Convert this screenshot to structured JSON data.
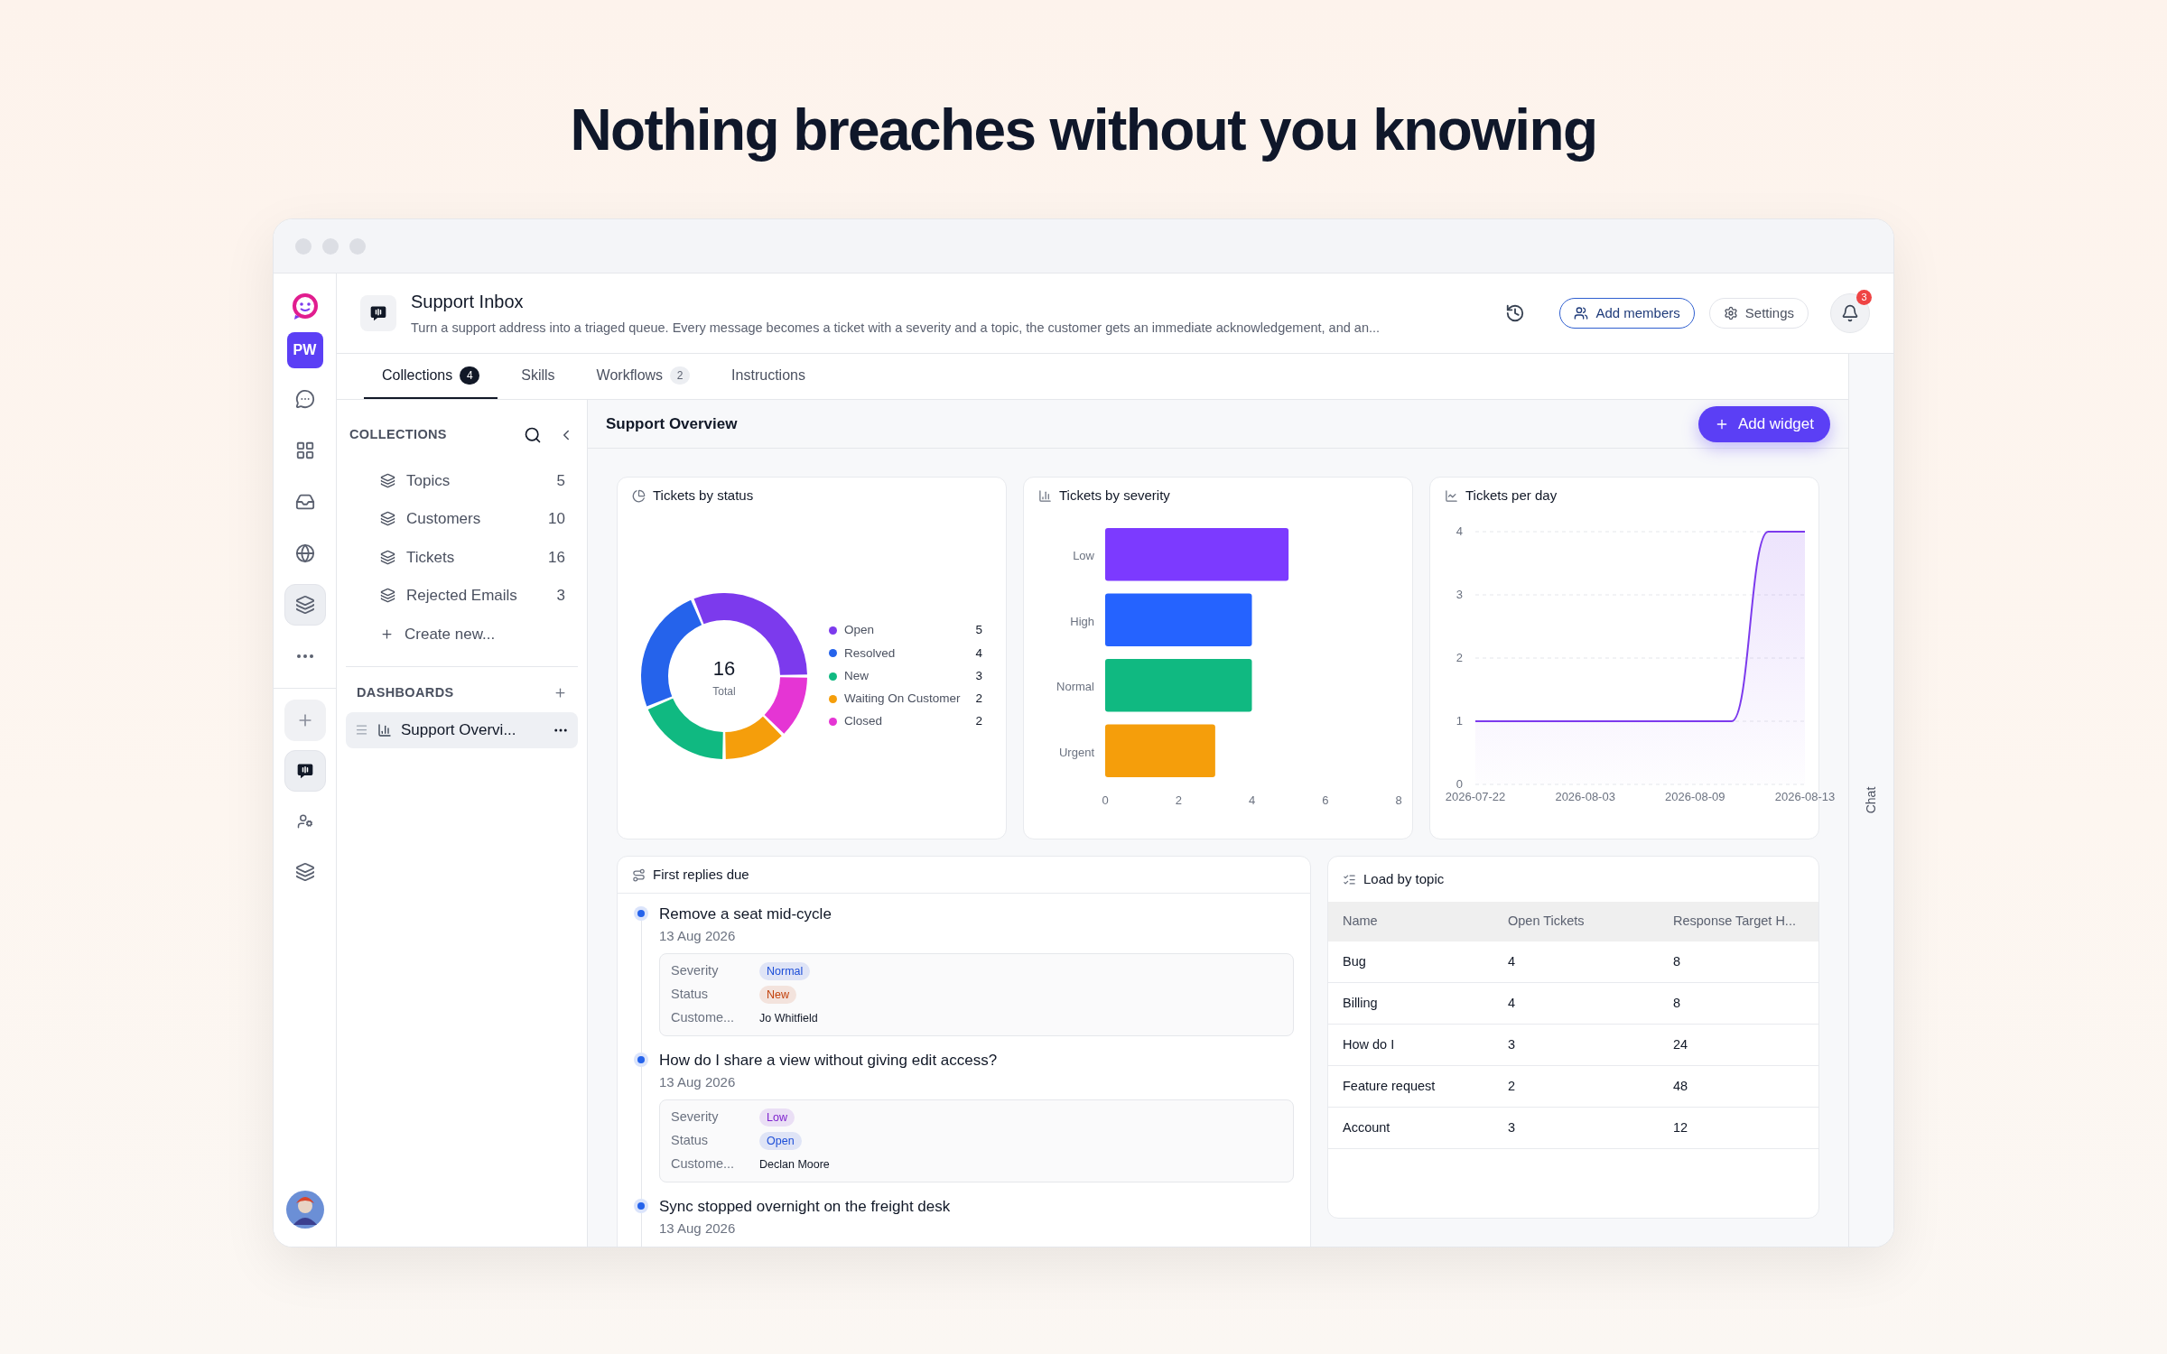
{
  "headline": "Nothing breaches without you knowing",
  "rail": {
    "top": [
      {
        "kind": "logo",
        "selected": false
      },
      {
        "kind": "initials",
        "label": "PW",
        "selected": false
      },
      {
        "kind": "chat",
        "selected": false
      },
      {
        "kind": "apps",
        "selected": false
      },
      {
        "kind": "inbox",
        "selected": false
      },
      {
        "kind": "globe",
        "selected": false
      },
      {
        "kind": "layers",
        "selected": true
      },
      {
        "kind": "more",
        "selected": false
      }
    ],
    "apps": [
      {
        "kind": "add",
        "selected": false
      },
      {
        "kind": "bot",
        "selected": true
      },
      {
        "kind": "person",
        "selected": false
      },
      {
        "kind": "layers",
        "selected": false
      }
    ]
  },
  "header": {
    "title": "Support Inbox",
    "description": "Turn a support address into a triaged queue. Every message becomes a ticket with a severity and a topic, the customer gets an immediate acknowledgement, and an...",
    "buttons": [
      {
        "kind": "accent",
        "label": "Add members"
      },
      {
        "kind": "plain",
        "label": "Settings"
      }
    ],
    "notifications": "3"
  },
  "tabs": [
    {
      "label": "Collections",
      "count": "4",
      "selected": true
    },
    {
      "label": "Skills",
      "selected": false
    },
    {
      "label": "Workflows",
      "count": "2",
      "selected": false
    },
    {
      "label": "Instructions",
      "selected": false
    }
  ],
  "collections": {
    "heading": "COLLECTIONS",
    "items": [
      {
        "label": "Topics",
        "count": "5"
      },
      {
        "label": "Customers",
        "count": "10"
      },
      {
        "label": "Tickets",
        "count": "16"
      },
      {
        "label": "Rejected Emails",
        "count": "3"
      }
    ],
    "create": "Create new..."
  },
  "dashboards": {
    "heading": "DASHBOARDS",
    "items": [
      {
        "label": "Support Overvi...",
        "selected": true
      }
    ]
  },
  "overview": {
    "title": "Support Overview",
    "add_widget": "Add widget"
  },
  "status_widget": {
    "title": "Tickets by status",
    "total": "16",
    "total_label": "Total",
    "legend_entries": [
      {
        "color": "#7c3aed"
      },
      {
        "color": "#2563eb"
      },
      {
        "color": "#10b981"
      },
      {
        "color": "#f59e0b"
      },
      {
        "color": "#e535d4"
      }
    ],
    "chart_data": {
      "type": "donut",
      "legend": "right",
      "value_labels": [
        "5",
        "4",
        "3",
        "2",
        "2"
      ],
      "categories": [
        "Open",
        "Resolved",
        "New",
        "Waiting On Customer",
        "Closed"
      ],
      "values": [
        5,
        4,
        3,
        2,
        2
      ]
    }
  },
  "severity_widget": {
    "title": "Tickets by severity",
    "chart_data": {
      "type": "bar",
      "orientation": "horizontal",
      "categories": [
        "Low",
        "High",
        "Normal",
        "Urgent"
      ],
      "values": [
        5,
        4,
        4,
        3
      ],
      "colors": [
        "#7c3aff",
        "#2563ff",
        "#10b981",
        "#f59e0b"
      ],
      "xlim": [
        0,
        8
      ],
      "xticks": [
        0,
        2,
        4,
        6,
        8
      ]
    }
  },
  "per_day_widget": {
    "title": "Tickets per day",
    "chart_data": {
      "type": "area",
      "categories": [
        "2026-07-22",
        null,
        null,
        "2026-08-03",
        null,
        null,
        "2026-08-09",
        null,
        null,
        "2026-08-13"
      ],
      "values": [
        1,
        1,
        1,
        1,
        1,
        1,
        1,
        1,
        4,
        4
      ],
      "grid": true,
      "ylim": [
        0,
        4
      ],
      "yticks": [
        0,
        1,
        2,
        3,
        4
      ]
    }
  },
  "first_replies": {
    "title": "First replies due",
    "items": [
      {
        "title": "Remove a seat mid-cycle",
        "date": "13 Aug 2026",
        "fields": [
          {
            "label": "Severity",
            "kind": "badge",
            "value": "Normal",
            "color": "#1d4ed8"
          },
          {
            "label": "Status",
            "kind": "badge",
            "value": "New",
            "color": "#c2410c"
          },
          {
            "label": "Custome...",
            "kind": "text",
            "value": "Jo Whitfield"
          }
        ]
      },
      {
        "title": "How do I share a view without giving edit access?",
        "date": "13 Aug 2026",
        "fields": [
          {
            "label": "Severity",
            "kind": "badge",
            "value": "Low",
            "color": "#7e22ce"
          },
          {
            "label": "Status",
            "kind": "badge",
            "value": "Open",
            "color": "#1d4ed8"
          },
          {
            "label": "Custome...",
            "kind": "text",
            "value": "Declan Moore"
          }
        ]
      },
      {
        "title": "Sync stopped overnight on the freight desk",
        "date": "13 Aug 2026"
      }
    ]
  },
  "load_by_topic": {
    "title": "Load by topic",
    "columns": [
      "Name",
      "Open Tickets",
      "Response Target H..."
    ],
    "rows": [
      [
        "Bug",
        "4",
        "8"
      ],
      [
        "Billing",
        "4",
        "8"
      ],
      [
        "How do I",
        "3",
        "24"
      ],
      [
        "Feature request",
        "2",
        "48"
      ],
      [
        "Account",
        "3",
        "12"
      ]
    ]
  },
  "chat_tab": "Chat"
}
